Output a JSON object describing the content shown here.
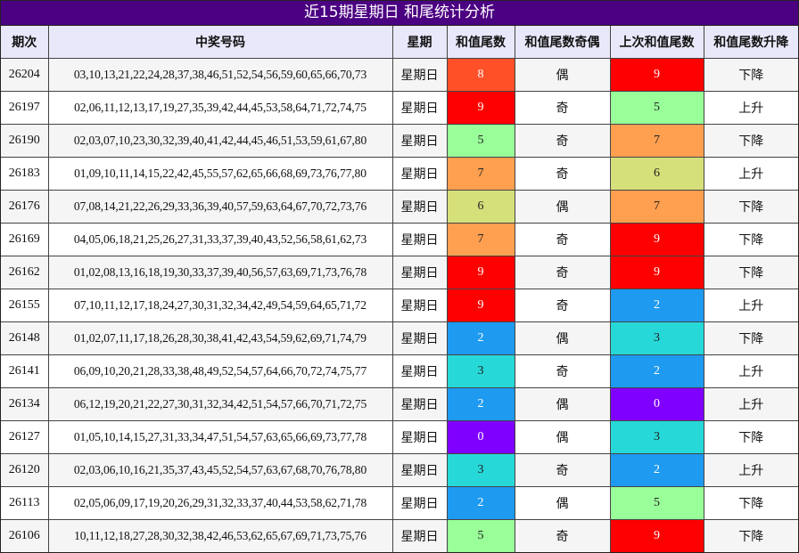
{
  "title": "近15期星期日 和尾统计分析",
  "headers": [
    "期次",
    "中奖号码",
    "星期",
    "和值尾数",
    "和值尾数奇偶",
    "上次和值尾数",
    "和值尾数升降"
  ],
  "tail_colors": {
    "0": "#8000ff",
    "2": "#1e9af0",
    "3": "#27d8d8",
    "5": "#99ff99",
    "6": "#d6e07a",
    "7": "#ff9f50",
    "8": "#ff5028",
    "9": "#ff0000"
  },
  "rows": [
    {
      "issue": "26204",
      "numbers": "03,10,13,21,22,24,28,37,38,46,51,52,54,56,59,60,65,66,70,73",
      "weekday": "星期日",
      "tail": "8",
      "parity": "偶",
      "prev_tail": "9",
      "trend": "下降"
    },
    {
      "issue": "26197",
      "numbers": "02,06,11,12,13,17,19,27,35,39,42,44,45,53,58,64,71,72,74,75",
      "weekday": "星期日",
      "tail": "9",
      "parity": "奇",
      "prev_tail": "5",
      "trend": "上升"
    },
    {
      "issue": "26190",
      "numbers": "02,03,07,10,23,30,32,39,40,41,42,44,45,46,51,53,59,61,67,80",
      "weekday": "星期日",
      "tail": "5",
      "parity": "奇",
      "prev_tail": "7",
      "trend": "下降"
    },
    {
      "issue": "26183",
      "numbers": "01,09,10,11,14,15,22,42,45,55,57,62,65,66,68,69,73,76,77,80",
      "weekday": "星期日",
      "tail": "7",
      "parity": "奇",
      "prev_tail": "6",
      "trend": "上升"
    },
    {
      "issue": "26176",
      "numbers": "07,08,14,21,22,26,29,33,36,39,40,57,59,63,64,67,70,72,73,76",
      "weekday": "星期日",
      "tail": "6",
      "parity": "偶",
      "prev_tail": "7",
      "trend": "下降"
    },
    {
      "issue": "26169",
      "numbers": "04,05,06,18,21,25,26,27,31,33,37,39,40,43,52,56,58,61,62,73",
      "weekday": "星期日",
      "tail": "7",
      "parity": "奇",
      "prev_tail": "9",
      "trend": "下降"
    },
    {
      "issue": "26162",
      "numbers": "01,02,08,13,16,18,19,30,33,37,39,40,56,57,63,69,71,73,76,78",
      "weekday": "星期日",
      "tail": "9",
      "parity": "奇",
      "prev_tail": "9",
      "trend": "下降"
    },
    {
      "issue": "26155",
      "numbers": "07,10,11,12,17,18,24,27,30,31,32,34,42,49,54,59,64,65,71,72",
      "weekday": "星期日",
      "tail": "9",
      "parity": "奇",
      "prev_tail": "2",
      "trend": "上升"
    },
    {
      "issue": "26148",
      "numbers": "01,02,07,11,17,18,26,28,30,38,41,42,43,54,59,62,69,71,74,79",
      "weekday": "星期日",
      "tail": "2",
      "parity": "偶",
      "prev_tail": "3",
      "trend": "下降"
    },
    {
      "issue": "26141",
      "numbers": "06,09,10,20,21,28,33,38,48,49,52,54,57,64,66,70,72,74,75,77",
      "weekday": "星期日",
      "tail": "3",
      "parity": "奇",
      "prev_tail": "2",
      "trend": "上升"
    },
    {
      "issue": "26134",
      "numbers": "06,12,19,20,21,22,27,30,31,32,34,42,51,54,57,66,70,71,72,75",
      "weekday": "星期日",
      "tail": "2",
      "parity": "偶",
      "prev_tail": "0",
      "trend": "上升"
    },
    {
      "issue": "26127",
      "numbers": "01,05,10,14,15,27,31,33,34,47,51,54,57,63,65,66,69,73,77,78",
      "weekday": "星期日",
      "tail": "0",
      "parity": "偶",
      "prev_tail": "3",
      "trend": "下降"
    },
    {
      "issue": "26120",
      "numbers": "02,03,06,10,16,21,35,37,43,45,52,54,57,63,67,68,70,76,78,80",
      "weekday": "星期日",
      "tail": "3",
      "parity": "奇",
      "prev_tail": "2",
      "trend": "上升"
    },
    {
      "issue": "26113",
      "numbers": "02,05,06,09,17,19,20,26,29,31,32,33,37,40,44,53,58,62,71,78",
      "weekday": "星期日",
      "tail": "2",
      "parity": "偶",
      "prev_tail": "5",
      "trend": "下降"
    },
    {
      "issue": "26106",
      "numbers": "10,11,12,18,27,28,30,32,38,42,46,53,62,65,67,69,71,73,75,76",
      "weekday": "星期日",
      "tail": "5",
      "parity": "奇",
      "prev_tail": "9",
      "trend": "下降"
    }
  ]
}
